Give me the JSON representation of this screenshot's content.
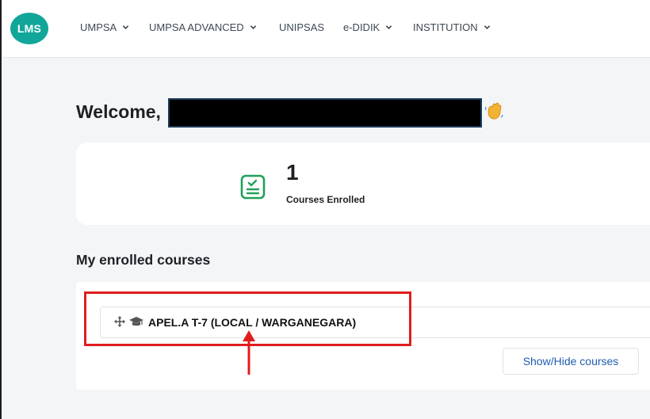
{
  "navbar": {
    "logo_text": "LMS",
    "items": [
      {
        "label": "UMPSA",
        "has_dropdown": true
      },
      {
        "label": "UMPSA ADVANCED",
        "has_dropdown": true
      },
      {
        "label": "UNIPSAS",
        "has_dropdown": false
      },
      {
        "label": "e-DIDIK",
        "has_dropdown": true
      },
      {
        "label": "INSTITUTION",
        "has_dropdown": true
      }
    ]
  },
  "welcome": {
    "greeting": "Welcome,",
    "icon": "waving-hand-icon"
  },
  "stats": {
    "courses_enrolled_count": "1",
    "courses_enrolled_label": "Courses Enrolled",
    "icon": "clipboard-check-icon"
  },
  "enrolled": {
    "title": "My enrolled courses",
    "courses": [
      {
        "name": "APEL.A T-7 (LOCAL / WARGANEGARA)",
        "icons": [
          "move-icon",
          "graduation-cap-icon"
        ]
      }
    ],
    "toggle_label": "Show/Hide courses"
  },
  "annotation": {
    "box_color": "#e01d1d",
    "arrow_color": "#e01d1d"
  },
  "colors": {
    "brand": "#12a69a",
    "stat_icon": "#22a05b",
    "link": "#1f5cae"
  }
}
